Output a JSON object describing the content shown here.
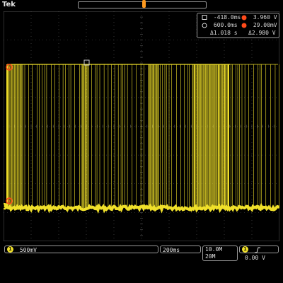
{
  "app": {
    "brand": "Tek"
  },
  "colors": {
    "ch1": "#f0e02a",
    "grid": "#5a5a5a",
    "cursor_marker": "#ff4a1a",
    "trigger_marker": "#ff9a1f",
    "readout_border": "#9a9a9a"
  },
  "cursor_readout": {
    "a_time": "-418.0ms",
    "a_volt": "3.960 V",
    "b_time": "600.0ms",
    "b_volt": "29.00mV",
    "delta_time": "Δ1.018 s",
    "delta_volt": "Δ2.980 V",
    "icons": [
      "cursor-a-square-icon",
      "cursor-a-marker-icon",
      "cursor-b-circle-icon",
      "cursor-b-marker-icon"
    ]
  },
  "markers": {
    "cursor_a_label": "a",
    "cursor_b_label": "b",
    "channel_ground_label": "1"
  },
  "bottom": {
    "ch1_scale": "500mV",
    "timebase": "200ms",
    "sample_rate": "10.0M",
    "record_length": "20M",
    "trigger_channel": "1",
    "trigger_slope_icon": "rising-edge-icon",
    "trigger_level": "0.00 V"
  }
}
